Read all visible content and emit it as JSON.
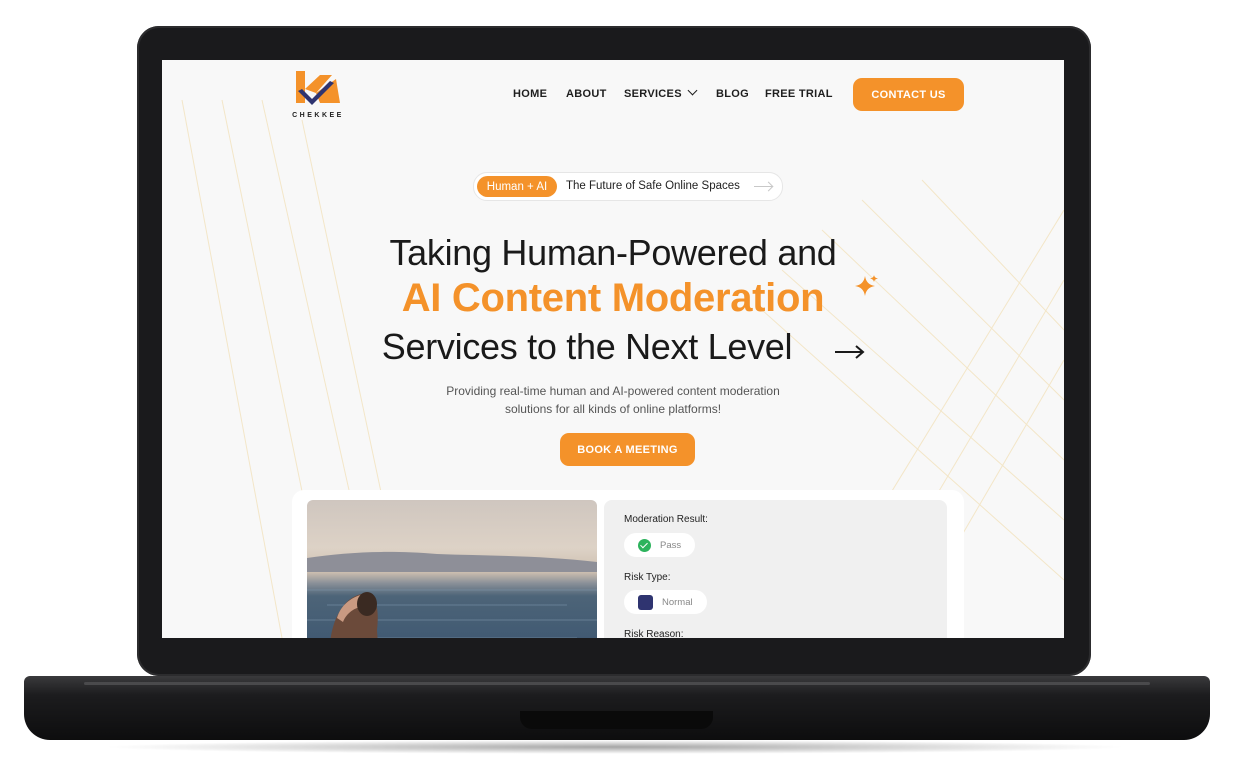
{
  "brand": {
    "name": "CHEKKEE",
    "orange": "#f4922a",
    "navy": "#2f3470"
  },
  "nav": {
    "items": [
      "HOME",
      "ABOUT",
      "SERVICES",
      "BLOG",
      "FREE TRIAL"
    ],
    "services_icon": "chevron-down-icon",
    "contact": "CONTACT US"
  },
  "hero": {
    "badge_tag": "Human + AI",
    "badge_text": "The Future of Safe Online Spaces",
    "line1": "Taking Human-Powered and",
    "line2": "AI Content Moderation",
    "line3": "Services to the Next Level",
    "sub1": "Providing real-time human and AI-powered content moderation",
    "sub2": "solutions for all kinds of online platforms!",
    "cta": "BOOK A MEETING"
  },
  "demo": {
    "result_label": "Moderation Result:",
    "result_value": "Pass",
    "risk_type_label": "Risk Type:",
    "risk_type_value": "Normal",
    "risk_reason_label": "Risk Reason:"
  }
}
